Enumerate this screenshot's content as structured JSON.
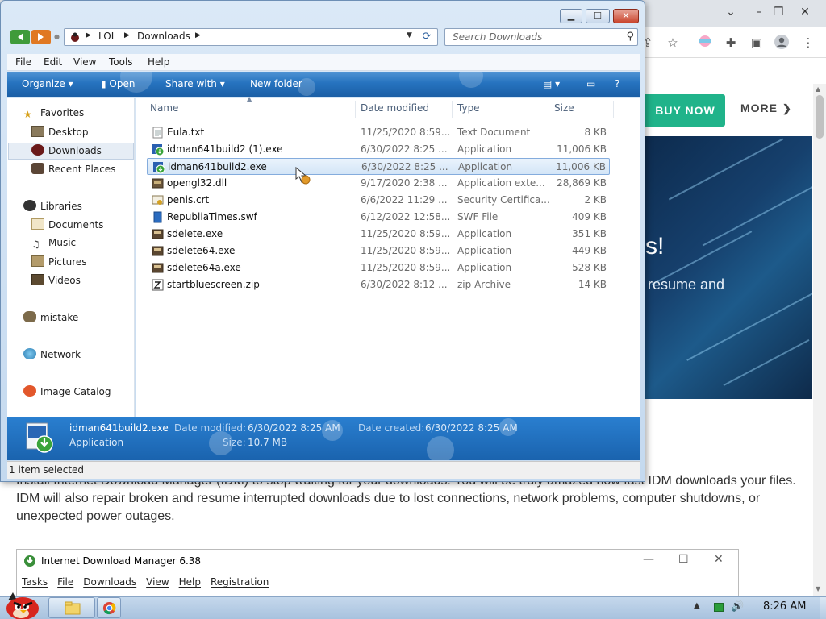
{
  "chrome": {
    "nav": {
      "buy_now": "BUY NOW",
      "more": "MORE"
    },
    "hero": {
      "heading": "s!",
      "subtext": "resume and"
    },
    "paragraph": "Install Internet Download Manager (IDM) to stop waiting for your downloads! You will be truly amazed how fast IDM downloads your files. IDM will also repair broken and resume interrupted downloads due to lost connections, network problems, computer shutdowns, or unexpected power outages."
  },
  "idm_window": {
    "title": "Internet Download Manager 6.38",
    "menu": [
      "Tasks",
      "File",
      "Downloads",
      "View",
      "Help",
      "Registration"
    ]
  },
  "explorer": {
    "breadcrumb": [
      "LOL",
      "Downloads"
    ],
    "search_placeholder": "Search Downloads",
    "menubar": [
      "File",
      "Edit",
      "View",
      "Tools",
      "Help"
    ],
    "commands": {
      "organize": "Organize",
      "open": "Open",
      "share_with": "Share with",
      "new_folder": "New folder"
    },
    "nav": {
      "favorites": "Favorites",
      "desktop": "Desktop",
      "downloads": "Downloads",
      "recent_places": "Recent Places",
      "libraries": "Libraries",
      "documents": "Documents",
      "music": "Music",
      "pictures": "Pictures",
      "videos": "Videos",
      "mistake": "mistake",
      "network": "Network",
      "image_catalog": "Image Catalog"
    },
    "columns": {
      "name": "Name",
      "date_modified": "Date modified",
      "type": "Type",
      "size": "Size"
    },
    "files": [
      {
        "name": "Eula.txt",
        "date": "11/25/2020 8:59...",
        "type": "Text Document",
        "size": "8 KB",
        "icon": "text-file-icon"
      },
      {
        "name": "idman641build2 (1).exe",
        "date": "6/30/2022 8:25 ...",
        "type": "Application",
        "size": "11,006 KB",
        "icon": "idm-app-icon"
      },
      {
        "name": "idman641build2.exe",
        "date": "6/30/2022 8:25 ...",
        "type": "Application",
        "size": "11,006 KB",
        "icon": "idm-app-icon"
      },
      {
        "name": "opengl32.dll",
        "date": "9/17/2020 2:38 ...",
        "type": "Application exte...",
        "size": "28,869 KB",
        "icon": "dll-file-icon"
      },
      {
        "name": "penis.crt",
        "date": "6/6/2022 11:29 ...",
        "type": "Security Certifica...",
        "size": "2 KB",
        "icon": "certificate-icon"
      },
      {
        "name": "RepubliaTimes.swf",
        "date": "6/12/2022 12:58...",
        "type": "SWF File",
        "size": "409 KB",
        "icon": "swf-file-icon"
      },
      {
        "name": "sdelete.exe",
        "date": "11/25/2020 8:59...",
        "type": "Application",
        "size": "351 KB",
        "icon": "exe-file-icon"
      },
      {
        "name": "sdelete64.exe",
        "date": "11/25/2020 8:59...",
        "type": "Application",
        "size": "449 KB",
        "icon": "exe-file-icon"
      },
      {
        "name": "sdelete64a.exe",
        "date": "11/25/2020 8:59...",
        "type": "Application",
        "size": "528 KB",
        "icon": "exe-file-icon"
      },
      {
        "name": "startbluescreen.zip",
        "date": "6/30/2022 8:12 ...",
        "type": "zip Archive",
        "size": "14 KB",
        "icon": "zip-file-icon"
      }
    ],
    "details": {
      "name": "idman641build2.exe",
      "kind": "Application",
      "date_modified_label": "Date modified:",
      "date_modified": "6/30/2022 8:25 AM",
      "date_created_label": "Date created:",
      "date_created": "6/30/2022 8:25 AM",
      "size_label": "Size:",
      "size": "10.7 MB"
    },
    "status": "1 item selected"
  },
  "taskbar": {
    "clock": "8:26 AM"
  }
}
